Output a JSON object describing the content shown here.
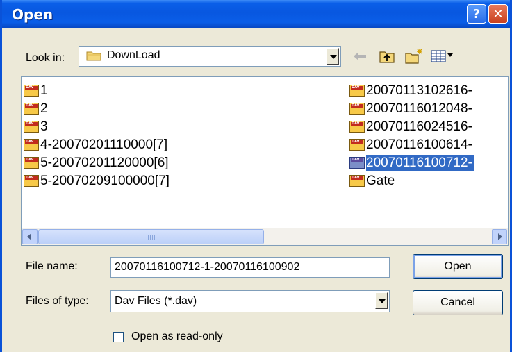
{
  "window": {
    "title": "Open",
    "help_glyph": "?",
    "close_glyph": "✕"
  },
  "look_in": {
    "label": "Look in:",
    "value": "DownLoad",
    "folder_icon": "folder-icon"
  },
  "toolbar": {
    "back_icon": "back-arrow-icon",
    "up_icon": "up-one-level-icon",
    "new_folder_icon": "new-folder-icon",
    "view_icon": "view-menu-icon"
  },
  "files": {
    "column1": [
      "1",
      "2",
      "3",
      "4-20070201110000[7]",
      "5-20070201120000[6]",
      "5-20070209100000[7]"
    ],
    "column2": [
      "20070113102616-",
      "20070116012048-",
      "20070116024516-",
      "20070116100614-",
      "20070116100712-",
      "Gate"
    ],
    "selected": "20070116100712-",
    "icon_label": "DAV"
  },
  "file_name": {
    "label": "File name:",
    "value": "20070116100712-1-20070116100902"
  },
  "file_type": {
    "label": "Files of type:",
    "value": "Dav Files (*.dav)"
  },
  "buttons": {
    "open": "Open",
    "cancel": "Cancel"
  },
  "read_only": {
    "label": "Open as read-only",
    "checked": false
  },
  "colors": {
    "title_bar": "#0a5fe8",
    "selection": "#316ac5",
    "dialog_bg": "#ece9d8"
  }
}
